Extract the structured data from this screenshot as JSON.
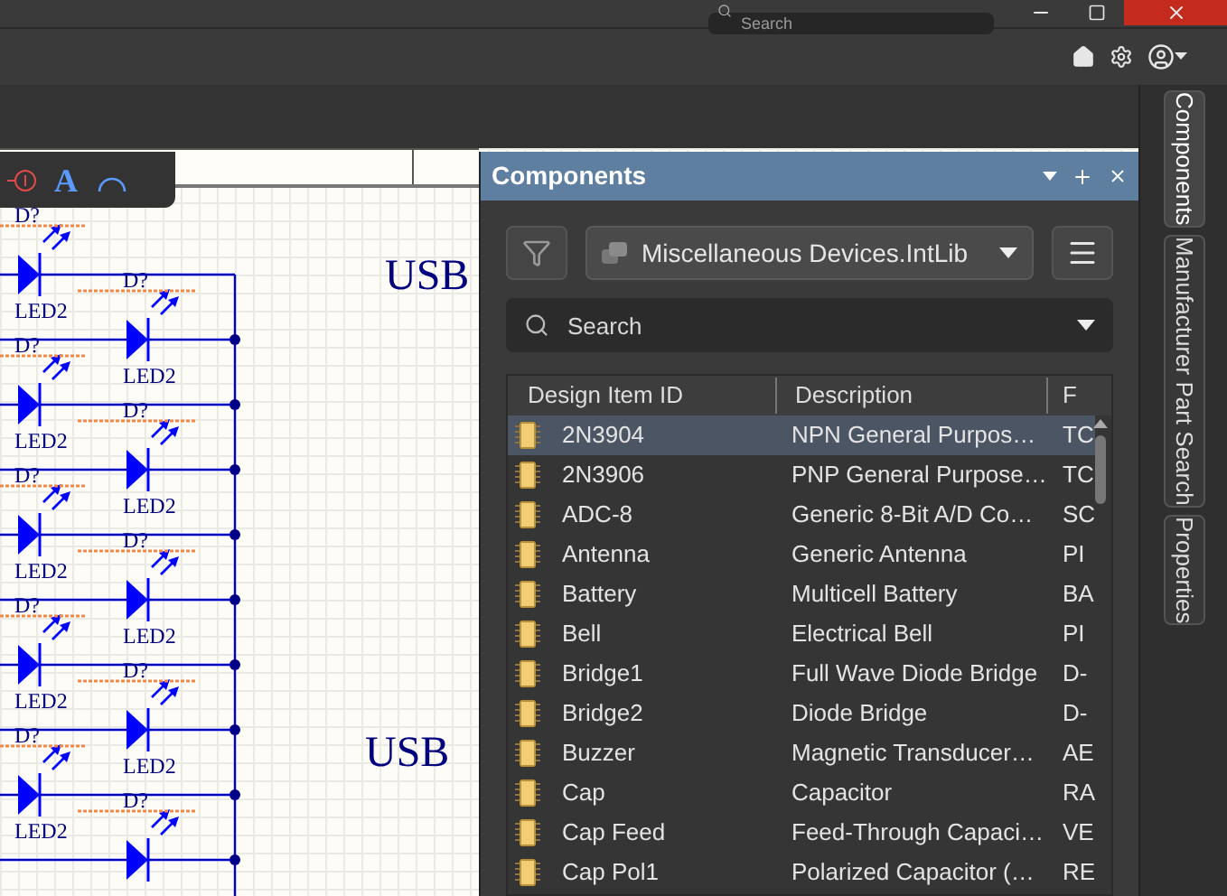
{
  "top_search": {
    "placeholder": "Search"
  },
  "toolbar": {
    "text_tool": "A"
  },
  "schematic": {
    "titles": [
      "USB",
      "USB"
    ],
    "leds": [
      {
        "kind": "left",
        "designator": "D?",
        "value": "LED2"
      },
      {
        "kind": "right",
        "designator": "D?",
        "value": "LED2"
      },
      {
        "kind": "left",
        "designator": "D?",
        "value": "LED2"
      },
      {
        "kind": "right",
        "designator": "D?",
        "value": "LED2"
      },
      {
        "kind": "left",
        "designator": "D?",
        "value": "LED2"
      },
      {
        "kind": "right",
        "designator": "D?",
        "value": "LED2"
      },
      {
        "kind": "left",
        "designator": "D?",
        "value": "LED2"
      },
      {
        "kind": "right",
        "designator": "D?",
        "value": "LED2"
      },
      {
        "kind": "left",
        "designator": "D?",
        "value": "LED2"
      },
      {
        "kind": "right",
        "designator": "D?"
      }
    ]
  },
  "panel": {
    "title": "Components",
    "library": "Miscellaneous Devices.IntLib",
    "search": {
      "placeholder": "Search"
    },
    "columns": [
      "Design Item ID",
      "Description",
      "F"
    ],
    "rows": [
      {
        "id": "2N3904",
        "description": "NPN General Purpos…",
        "footprint": "TC",
        "selected": true
      },
      {
        "id": "2N3906",
        "description": "PNP General Purpose…",
        "footprint": "TC",
        "selected": false
      },
      {
        "id": "ADC-8",
        "description": "Generic 8-Bit A/D Co…",
        "footprint": "SC",
        "selected": false
      },
      {
        "id": "Antenna",
        "description": "Generic Antenna",
        "footprint": "PI",
        "selected": false
      },
      {
        "id": "Battery",
        "description": "Multicell Battery",
        "footprint": "BA",
        "selected": false
      },
      {
        "id": "Bell",
        "description": "Electrical Bell",
        "footprint": "PI",
        "selected": false
      },
      {
        "id": "Bridge1",
        "description": "Full Wave Diode Bridge",
        "footprint": "D-",
        "selected": false
      },
      {
        "id": "Bridge2",
        "description": "Diode Bridge",
        "footprint": "D-",
        "selected": false
      },
      {
        "id": "Buzzer",
        "description": "Magnetic Transducer…",
        "footprint": "AE",
        "selected": false
      },
      {
        "id": "Cap",
        "description": "Capacitor",
        "footprint": "RA",
        "selected": false
      },
      {
        "id": "Cap Feed",
        "description": "Feed-Through Capaci…",
        "footprint": "VE",
        "selected": false
      },
      {
        "id": "Cap Pol1",
        "description": "Polarized Capacitor (…",
        "footprint": "RE",
        "selected": false
      }
    ]
  },
  "side_tabs": [
    {
      "label": "Components",
      "selected": true
    },
    {
      "label": "Manufacturer Part Search",
      "selected": false
    },
    {
      "label": "Properties",
      "selected": false
    }
  ]
}
